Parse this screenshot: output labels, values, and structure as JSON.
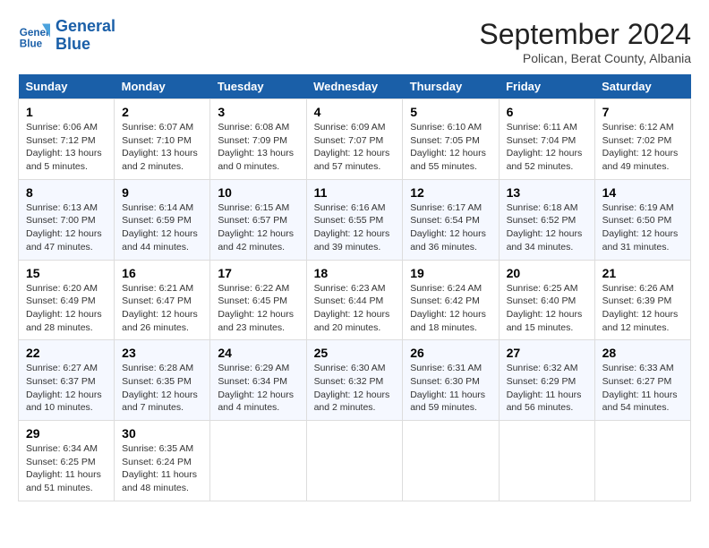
{
  "header": {
    "logo_line1": "General",
    "logo_line2": "Blue",
    "month": "September 2024",
    "location": "Polican, Berat County, Albania"
  },
  "weekdays": [
    "Sunday",
    "Monday",
    "Tuesday",
    "Wednesday",
    "Thursday",
    "Friday",
    "Saturday"
  ],
  "weeks": [
    [
      {
        "day": "1",
        "sunrise": "6:06 AM",
        "sunset": "7:12 PM",
        "daylight": "13 hours and 5 minutes."
      },
      {
        "day": "2",
        "sunrise": "6:07 AM",
        "sunset": "7:10 PM",
        "daylight": "13 hours and 2 minutes."
      },
      {
        "day": "3",
        "sunrise": "6:08 AM",
        "sunset": "7:09 PM",
        "daylight": "13 hours and 0 minutes."
      },
      {
        "day": "4",
        "sunrise": "6:09 AM",
        "sunset": "7:07 PM",
        "daylight": "12 hours and 57 minutes."
      },
      {
        "day": "5",
        "sunrise": "6:10 AM",
        "sunset": "7:05 PM",
        "daylight": "12 hours and 55 minutes."
      },
      {
        "day": "6",
        "sunrise": "6:11 AM",
        "sunset": "7:04 PM",
        "daylight": "12 hours and 52 minutes."
      },
      {
        "day": "7",
        "sunrise": "6:12 AM",
        "sunset": "7:02 PM",
        "daylight": "12 hours and 49 minutes."
      }
    ],
    [
      {
        "day": "8",
        "sunrise": "6:13 AM",
        "sunset": "7:00 PM",
        "daylight": "12 hours and 47 minutes."
      },
      {
        "day": "9",
        "sunrise": "6:14 AM",
        "sunset": "6:59 PM",
        "daylight": "12 hours and 44 minutes."
      },
      {
        "day": "10",
        "sunrise": "6:15 AM",
        "sunset": "6:57 PM",
        "daylight": "12 hours and 42 minutes."
      },
      {
        "day": "11",
        "sunrise": "6:16 AM",
        "sunset": "6:55 PM",
        "daylight": "12 hours and 39 minutes."
      },
      {
        "day": "12",
        "sunrise": "6:17 AM",
        "sunset": "6:54 PM",
        "daylight": "12 hours and 36 minutes."
      },
      {
        "day": "13",
        "sunrise": "6:18 AM",
        "sunset": "6:52 PM",
        "daylight": "12 hours and 34 minutes."
      },
      {
        "day": "14",
        "sunrise": "6:19 AM",
        "sunset": "6:50 PM",
        "daylight": "12 hours and 31 minutes."
      }
    ],
    [
      {
        "day": "15",
        "sunrise": "6:20 AM",
        "sunset": "6:49 PM",
        "daylight": "12 hours and 28 minutes."
      },
      {
        "day": "16",
        "sunrise": "6:21 AM",
        "sunset": "6:47 PM",
        "daylight": "12 hours and 26 minutes."
      },
      {
        "day": "17",
        "sunrise": "6:22 AM",
        "sunset": "6:45 PM",
        "daylight": "12 hours and 23 minutes."
      },
      {
        "day": "18",
        "sunrise": "6:23 AM",
        "sunset": "6:44 PM",
        "daylight": "12 hours and 20 minutes."
      },
      {
        "day": "19",
        "sunrise": "6:24 AM",
        "sunset": "6:42 PM",
        "daylight": "12 hours and 18 minutes."
      },
      {
        "day": "20",
        "sunrise": "6:25 AM",
        "sunset": "6:40 PM",
        "daylight": "12 hours and 15 minutes."
      },
      {
        "day": "21",
        "sunrise": "6:26 AM",
        "sunset": "6:39 PM",
        "daylight": "12 hours and 12 minutes."
      }
    ],
    [
      {
        "day": "22",
        "sunrise": "6:27 AM",
        "sunset": "6:37 PM",
        "daylight": "12 hours and 10 minutes."
      },
      {
        "day": "23",
        "sunrise": "6:28 AM",
        "sunset": "6:35 PM",
        "daylight": "12 hours and 7 minutes."
      },
      {
        "day": "24",
        "sunrise": "6:29 AM",
        "sunset": "6:34 PM",
        "daylight": "12 hours and 4 minutes."
      },
      {
        "day": "25",
        "sunrise": "6:30 AM",
        "sunset": "6:32 PM",
        "daylight": "12 hours and 2 minutes."
      },
      {
        "day": "26",
        "sunrise": "6:31 AM",
        "sunset": "6:30 PM",
        "daylight": "11 hours and 59 minutes."
      },
      {
        "day": "27",
        "sunrise": "6:32 AM",
        "sunset": "6:29 PM",
        "daylight": "11 hours and 56 minutes."
      },
      {
        "day": "28",
        "sunrise": "6:33 AM",
        "sunset": "6:27 PM",
        "daylight": "11 hours and 54 minutes."
      }
    ],
    [
      {
        "day": "29",
        "sunrise": "6:34 AM",
        "sunset": "6:25 PM",
        "daylight": "11 hours and 51 minutes."
      },
      {
        "day": "30",
        "sunrise": "6:35 AM",
        "sunset": "6:24 PM",
        "daylight": "11 hours and 48 minutes."
      },
      null,
      null,
      null,
      null,
      null
    ]
  ]
}
